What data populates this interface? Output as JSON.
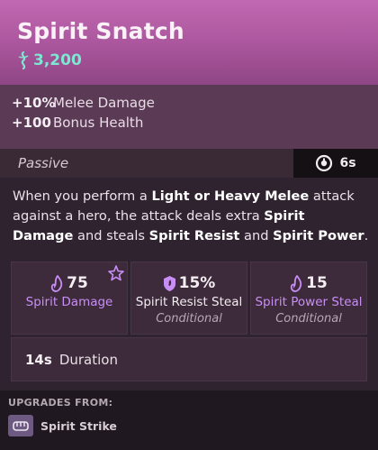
{
  "item": {
    "title": "Spirit Snatch",
    "cost": "3,200",
    "cost_icon": "soul-currency-icon"
  },
  "stats": [
    {
      "value": "+10%",
      "label": "Melee Damage"
    },
    {
      "value": "+100",
      "label": "Bonus Health"
    }
  ],
  "passive": {
    "label": "Passive",
    "cooldown": "6s",
    "cooldown_icon": "cooldown-clock-icon"
  },
  "description": {
    "p1": "When you perform a ",
    "b1": "Light or Heavy Melee",
    "p2": " attack against a hero, the attack deals extra ",
    "b2": "Spirit Damage",
    "p3": " and steals ",
    "b3": "Spirit Resist",
    "p4": " and ",
    "b4": "Spirit Power",
    "p5": "."
  },
  "effects": [
    {
      "value": "75",
      "label": "Spirit Damage",
      "conditional": "",
      "icon": "spirit-flame-icon"
    },
    {
      "value": "15%",
      "label": "Spirit Resist Steal",
      "conditional": "Conditional",
      "icon": "spirit-shield-icon"
    },
    {
      "value": "15",
      "label": "Spirit Power Steal",
      "conditional": "Conditional",
      "icon": "spirit-flame-icon"
    }
  ],
  "duration": {
    "value": "14s",
    "label": "Duration"
  },
  "upgrades": {
    "title": "UPGRADES FROM:",
    "items": [
      {
        "name": "Spirit Strike",
        "icon": "fist-icon"
      }
    ]
  },
  "colors": {
    "header": "#b35ea6",
    "cost": "#7fe6d2",
    "spirit_purple": "#c98ef6"
  }
}
